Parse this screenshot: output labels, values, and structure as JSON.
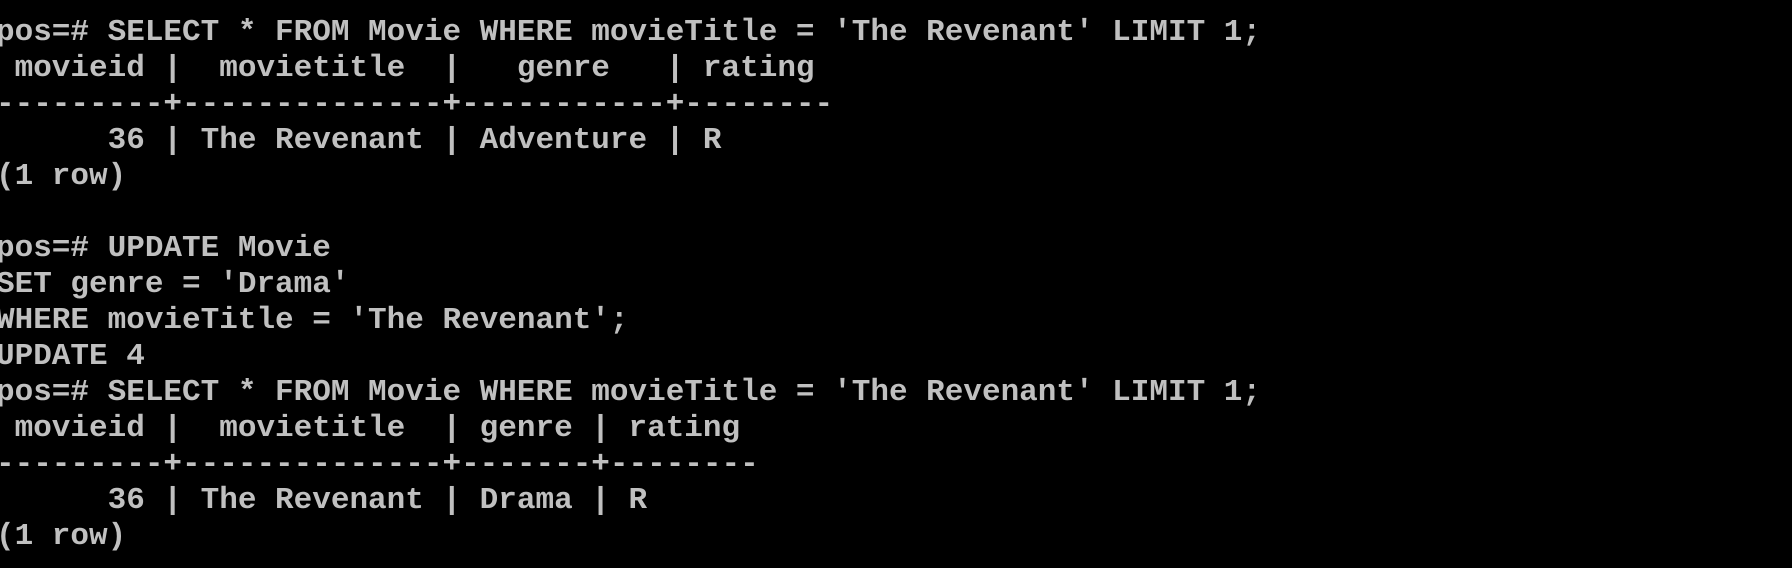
{
  "terminal": {
    "text_color": "#c0c0c0",
    "background": "#000000",
    "lines": [
      "pos=# SELECT * FROM Movie WHERE movieTitle = 'The Revenant' LIMIT 1;",
      " movieid |  movietitle  |   genre   | rating",
      "---------+--------------+-----------+--------",
      "      36 | The Revenant | Adventure | R",
      "(1 row)",
      "",
      "pos=# UPDATE Movie",
      "SET genre = 'Drama'",
      "WHERE movieTitle = 'The Revenant';",
      "UPDATE 4",
      "pos=# SELECT * FROM Movie WHERE movieTitle = 'The Revenant' LIMIT 1;",
      " movieid |  movietitle  | genre | rating",
      "---------+--------------+-------+--------",
      "      36 | The Revenant | Drama | R",
      "(1 row)"
    ]
  }
}
